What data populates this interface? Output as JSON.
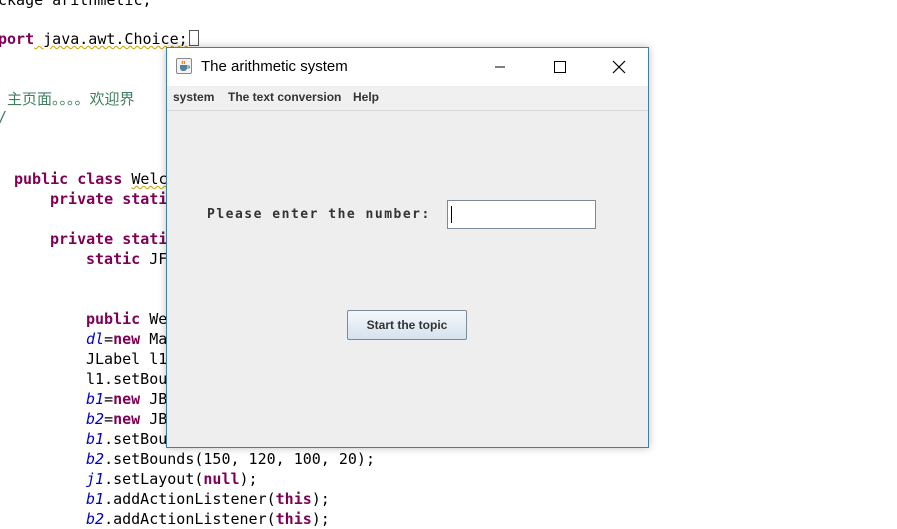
{
  "editor": {
    "lines": {
      "l0_part1": "ckage arithmetic;",
      "l1_kw": "port",
      "l1_rest": " java.awt.Choice;",
      "l2_comment": " 主页面。。。。欢迎界",
      "l3_comment": "/",
      "l4_kw1": "public",
      "l4_kw2": "class",
      "l4_rest": "Welc",
      "l5_kw1": "private",
      "l5_kw2": "stati",
      "l6_kw1": "private",
      "l6_kw2": "stati",
      "l7_kw": "static",
      "l7_rest": " JF",
      "l8_kw": "public",
      "l8_rest": " We",
      "l9_fld": "dl",
      "l9_eq": "=",
      "l9_kw": "new",
      "l9_rest": " Ma",
      "l10_text": "JLabel l1",
      "l11_text": "l1.setBou",
      "l12_fld": "b1",
      "l12_eq": "=",
      "l12_kw": "new",
      "l12_rest": " JB",
      "l13_fld": "b2",
      "l13_eq": "=",
      "l13_kw": "new",
      "l13_rest": " JB",
      "l14_fld": "b1",
      "l14_rest": ".setBou",
      "l15_fld": "b2",
      "l15_rest": ".setBounds(150, 120, 100, 20);",
      "l16_fld": "j1",
      "l16_a": ".setLayout(",
      "l16_kw": "null",
      "l16_b": ");",
      "l17_fld": "b1",
      "l17_a": ".addActionListener(",
      "l17_kw": "this",
      "l17_b": ");",
      "l18_fld": "b2",
      "l18_a": ".addActionListener(",
      "l18_kw": "this",
      "l18_b": ");"
    }
  },
  "window": {
    "title": "The arithmetic system",
    "icon": "java-coffee-cup-icon",
    "controls": [
      "minimize-icon",
      "maximize-icon",
      "close-icon"
    ],
    "menu": [
      "system",
      "The text conversion",
      "Help"
    ],
    "prompt_label": "Please enter the number:",
    "number_input_value": "",
    "start_button_label": "Start the topic"
  },
  "colors": {
    "keyword": "#7f0055",
    "field": "#0000c0",
    "comment": "#3f7f5f",
    "window_border": "#3c7fb1",
    "window_bg": "#eeeeee"
  }
}
